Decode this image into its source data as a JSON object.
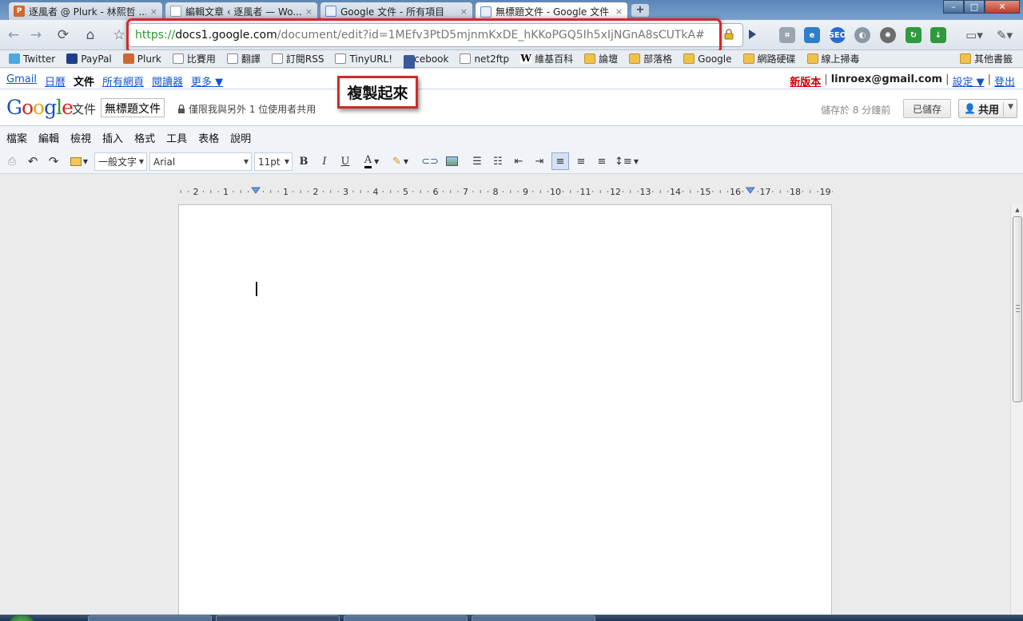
{
  "browser": {
    "tabs": [
      {
        "title": "逐風者 @ Plurk - 林熙哲 ...",
        "favicon": "plurk-icon",
        "active": false
      },
      {
        "title": "編輯文章 ‹ 逐風者 — Wo...",
        "favicon": "document-icon",
        "active": false
      },
      {
        "title": "Google 文件 - 所有項目",
        "favicon": "google-docs-icon",
        "active": false
      },
      {
        "title": "無標題文件 - Google 文件",
        "favicon": "google-docs-icon",
        "active": true
      }
    ],
    "new_tab": "+",
    "close_glyph": "×",
    "window_controls": {
      "minimize": "–",
      "maximize": "□",
      "close": "✕"
    },
    "url": {
      "scheme": "https://",
      "host": "docs1.google.com",
      "path": "/document/edit?id=1MEfv3PtD5mjnmKxDE_hKKoPGQ5Ih5xIjNGnA8sCUTkA#"
    },
    "bookmarks": [
      {
        "label": "Twitter",
        "icon": "twitter"
      },
      {
        "label": "PayPal",
        "icon": "paypal"
      },
      {
        "label": "Plurk",
        "icon": "plurk"
      },
      {
        "label": "比賽用",
        "icon": "page"
      },
      {
        "label": "翻譯",
        "icon": "page"
      },
      {
        "label": "訂閱RSS",
        "icon": "page"
      },
      {
        "label": "TinyURL!",
        "icon": "page"
      },
      {
        "label": "Facebook",
        "icon": "fb"
      },
      {
        "label": "net2ftp",
        "icon": "page"
      },
      {
        "label": "維基百科",
        "icon": "wiki"
      },
      {
        "label": "論壇",
        "icon": "folder"
      },
      {
        "label": "部落格",
        "icon": "folder"
      },
      {
        "label": "Google",
        "icon": "folder"
      },
      {
        "label": "網路硬碟",
        "icon": "folder"
      },
      {
        "label": "線上掃毒",
        "icon": "folder"
      }
    ],
    "other_bookmarks": "其他書籤"
  },
  "gbar": {
    "links": [
      "Gmail",
      "日曆",
      "文件",
      "所有網頁",
      "閱讀器",
      "更多 ▼"
    ],
    "active_link": "文件",
    "new_version": "新版本",
    "email": "linroex@gmail.com",
    "settings": "設定 ▼",
    "signout": "登出",
    "separator": "|"
  },
  "doc": {
    "logo": {
      "letters": [
        "G",
        "o",
        "o",
        "g",
        "l",
        "e"
      ],
      "colors": [
        "#1a4fbf",
        "#d3281f",
        "#e8a70f",
        "#1a4fbf",
        "#2c9a2c",
        "#d3281f"
      ]
    },
    "docs_label": "文件",
    "title": "無標題文件",
    "share_note": "僅限我與另外 1 位使用者共用",
    "save_status": "儲存於 8 分鐘前",
    "saved_button": "已儲存",
    "share_button": "共用"
  },
  "callout": "複製起來",
  "menus": [
    "檔案",
    "編輯",
    "檢視",
    "插入",
    "格式",
    "工具",
    "表格",
    "說明"
  ],
  "format_toolbar": {
    "style": "一般文字",
    "font": "Arial",
    "size": "11pt",
    "bold": "B",
    "italic": "I",
    "underline": "U",
    "text_color": "A",
    "alignment": "left"
  },
  "ruler": {
    "labels": [
      "2",
      "1",
      "1",
      "2",
      "3",
      "4",
      "5",
      "6",
      "7",
      "8",
      "9",
      "10",
      "11",
      "12",
      "13",
      "14",
      "15",
      "16",
      "17",
      "18",
      "19"
    ]
  }
}
